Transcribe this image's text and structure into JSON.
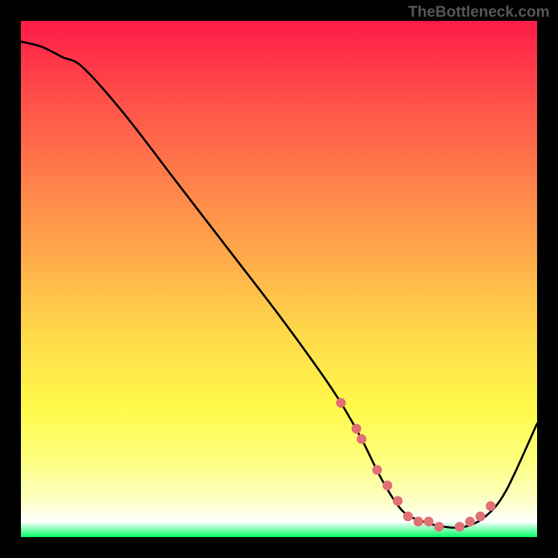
{
  "watermark": "TheBottleneck.com",
  "chart_data": {
    "type": "line",
    "title": "",
    "xlabel": "",
    "ylabel": "",
    "xlim": [
      0,
      100
    ],
    "ylim": [
      0,
      100
    ],
    "series": [
      {
        "name": "curve",
        "x": [
          0,
          4,
          8,
          12,
          20,
          30,
          40,
          50,
          58,
          62,
          66,
          70,
          74,
          78,
          82,
          86,
          90,
          94,
          100
        ],
        "y": [
          96,
          95,
          93,
          91,
          82,
          69,
          56,
          43,
          32,
          26,
          19,
          11,
          5,
          3,
          2,
          2,
          4,
          9,
          22
        ]
      }
    ],
    "markers": {
      "name": "highlight-points",
      "color": "#e07074",
      "x": [
        62,
        65,
        66,
        69,
        71,
        73,
        75,
        77,
        79,
        81,
        85,
        87,
        89,
        91
      ],
      "y": [
        26,
        21,
        19,
        13,
        10,
        7,
        4,
        3,
        3,
        2,
        2,
        3,
        4,
        6
      ]
    }
  }
}
